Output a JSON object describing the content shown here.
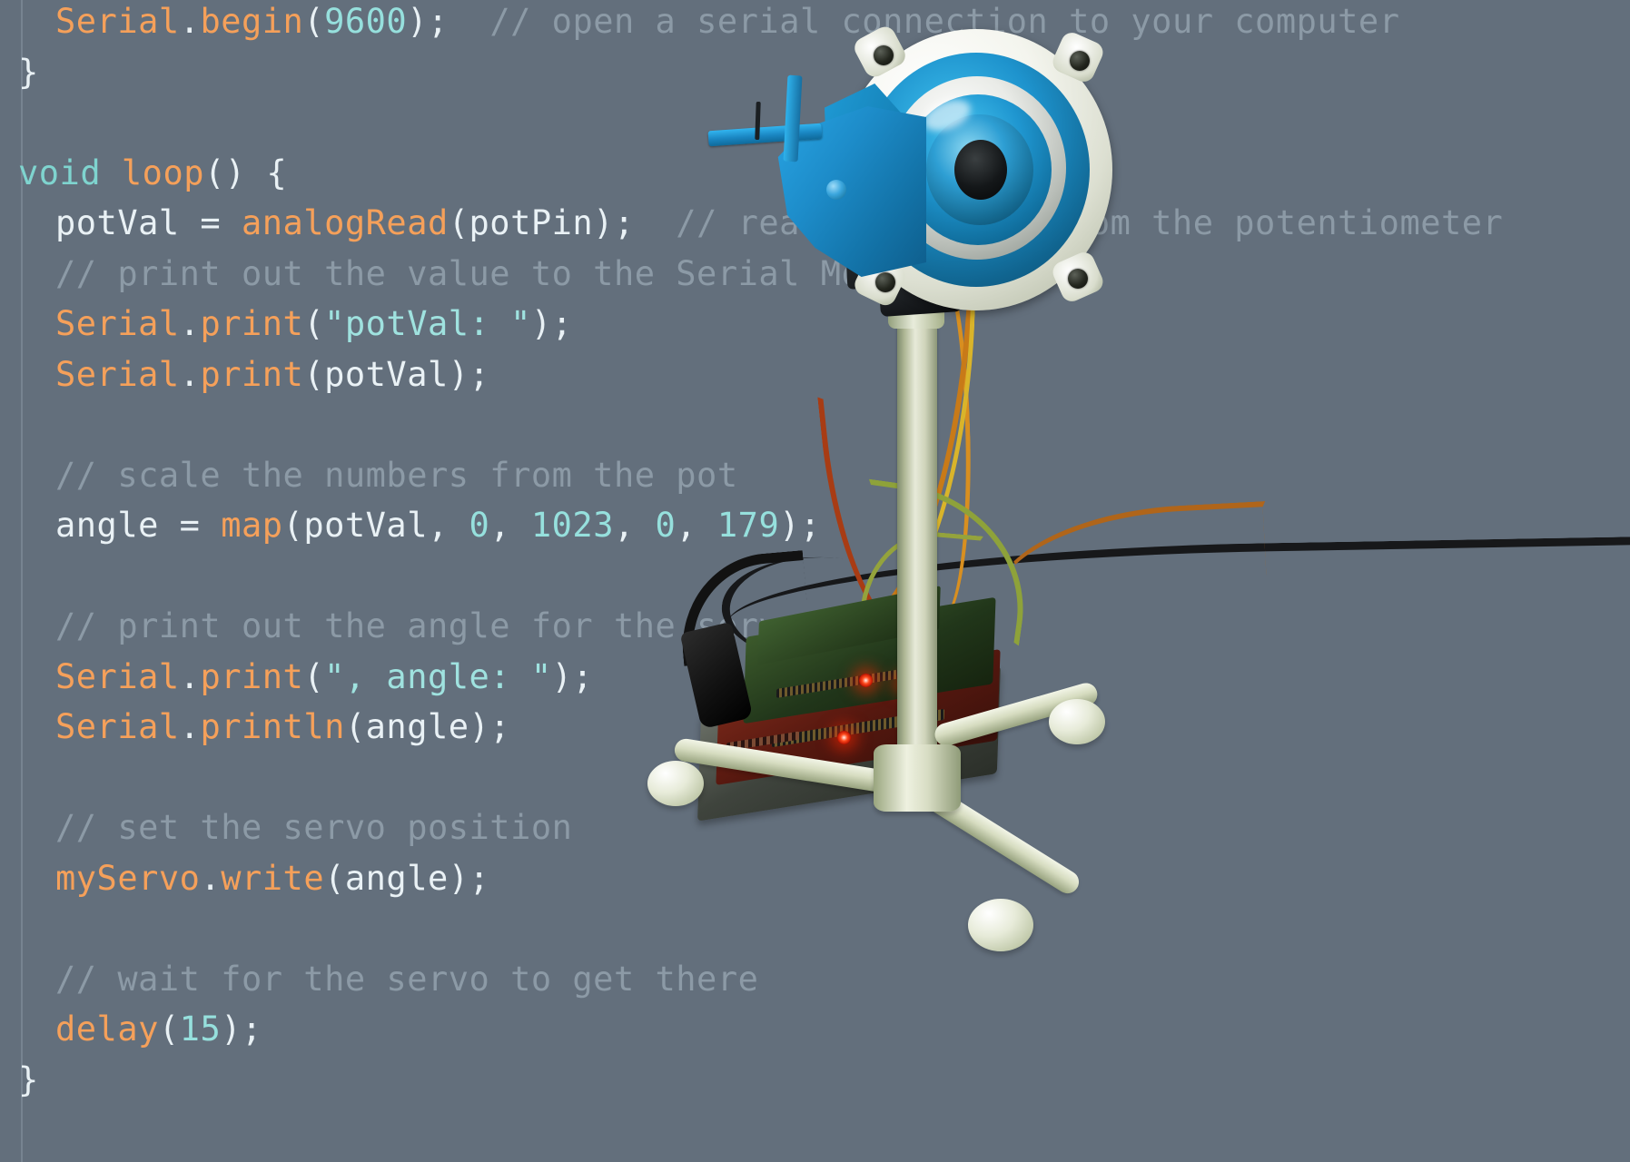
{
  "editor": {
    "language": "arduino",
    "background_color": "#636f7c",
    "comment_color": "#8c9aa6",
    "function_color": "#f5a05a",
    "keyword_color": "#7fd4cf",
    "number_color": "#96e0dd",
    "plain_color": "#e9f1f5",
    "lines": [
      {
        "indent": 1,
        "tokens": [
          {
            "t": "obj",
            "v": "Serial"
          },
          {
            "t": "plain",
            "v": "."
          },
          {
            "t": "fn",
            "v": "begin"
          },
          {
            "t": "plain",
            "v": "("
          },
          {
            "t": "num",
            "v": "9600"
          },
          {
            "t": "plain",
            "v": ");"
          },
          {
            "t": "plain",
            "v": "  "
          },
          {
            "t": "cmt",
            "v": "// open a serial connection to your computer"
          }
        ]
      },
      {
        "indent": 0,
        "tokens": [
          {
            "t": "brace",
            "v": "}"
          }
        ]
      },
      {
        "indent": 0,
        "tokens": []
      },
      {
        "indent": 0,
        "tokens": [
          {
            "t": "kw",
            "v": "void"
          },
          {
            "t": "plain",
            "v": " "
          },
          {
            "t": "fn",
            "v": "loop"
          },
          {
            "t": "plain",
            "v": "() "
          },
          {
            "t": "brace",
            "v": "{"
          }
        ]
      },
      {
        "indent": 1,
        "tokens": [
          {
            "t": "plain",
            "v": "potVal = "
          },
          {
            "t": "fn",
            "v": "analogRead"
          },
          {
            "t": "plain",
            "v": "(potPin);"
          },
          {
            "t": "plain",
            "v": "  "
          },
          {
            "t": "cmt",
            "v": "// read the value from the potentiometer"
          }
        ]
      },
      {
        "indent": 1,
        "tokens": [
          {
            "t": "cmt",
            "v": "// print out the value to the Serial Monitor"
          }
        ]
      },
      {
        "indent": 1,
        "tokens": [
          {
            "t": "obj",
            "v": "Serial"
          },
          {
            "t": "plain",
            "v": "."
          },
          {
            "t": "fn",
            "v": "print"
          },
          {
            "t": "plain",
            "v": "("
          },
          {
            "t": "str",
            "v": "\"potVal: \""
          },
          {
            "t": "plain",
            "v": ");"
          }
        ]
      },
      {
        "indent": 1,
        "tokens": [
          {
            "t": "obj",
            "v": "Serial"
          },
          {
            "t": "plain",
            "v": "."
          },
          {
            "t": "fn",
            "v": "print"
          },
          {
            "t": "plain",
            "v": "(potVal);"
          }
        ]
      },
      {
        "indent": 0,
        "tokens": []
      },
      {
        "indent": 1,
        "tokens": [
          {
            "t": "cmt",
            "v": "// scale the numbers from the pot"
          }
        ]
      },
      {
        "indent": 1,
        "tokens": [
          {
            "t": "plain",
            "v": "angle = "
          },
          {
            "t": "fn",
            "v": "map"
          },
          {
            "t": "plain",
            "v": "(potVal, "
          },
          {
            "t": "num",
            "v": "0"
          },
          {
            "t": "plain",
            "v": ", "
          },
          {
            "t": "num",
            "v": "1023"
          },
          {
            "t": "plain",
            "v": ", "
          },
          {
            "t": "num",
            "v": "0"
          },
          {
            "t": "plain",
            "v": ", "
          },
          {
            "t": "num",
            "v": "179"
          },
          {
            "t": "plain",
            "v": ");"
          }
        ]
      },
      {
        "indent": 0,
        "tokens": []
      },
      {
        "indent": 1,
        "tokens": [
          {
            "t": "cmt",
            "v": "// print out the angle for the servo motor"
          }
        ]
      },
      {
        "indent": 1,
        "tokens": [
          {
            "t": "obj",
            "v": "Serial"
          },
          {
            "t": "plain",
            "v": "."
          },
          {
            "t": "fn",
            "v": "print"
          },
          {
            "t": "plain",
            "v": "("
          },
          {
            "t": "str",
            "v": "\", angle: \""
          },
          {
            "t": "plain",
            "v": ");"
          }
        ]
      },
      {
        "indent": 1,
        "tokens": [
          {
            "t": "obj",
            "v": "Serial"
          },
          {
            "t": "plain",
            "v": "."
          },
          {
            "t": "fn",
            "v": "println"
          },
          {
            "t": "plain",
            "v": "(angle);"
          }
        ]
      },
      {
        "indent": 0,
        "tokens": []
      },
      {
        "indent": 1,
        "tokens": [
          {
            "t": "cmt",
            "v": "// set the servo position"
          }
        ]
      },
      {
        "indent": 1,
        "tokens": [
          {
            "t": "obj",
            "v": "myServo"
          },
          {
            "t": "plain",
            "v": "."
          },
          {
            "t": "fn",
            "v": "write"
          },
          {
            "t": "plain",
            "v": "(angle);"
          }
        ]
      },
      {
        "indent": 0,
        "tokens": []
      },
      {
        "indent": 1,
        "tokens": [
          {
            "t": "cmt",
            "v": "// wait for the servo to get there"
          }
        ]
      },
      {
        "indent": 1,
        "tokens": [
          {
            "t": "fn",
            "v": "delay"
          },
          {
            "t": "plain",
            "v": "("
          },
          {
            "t": "num",
            "v": "15"
          },
          {
            "t": "plain",
            "v": ");"
          }
        ]
      },
      {
        "indent": 0,
        "tokens": [
          {
            "t": "brace",
            "v": "}"
          }
        ]
      }
    ]
  },
  "photo": {
    "subject": "3d-printed-robotic-eye-on-tripod-with-arduino",
    "eye_pupil_color": "#141719",
    "eye_iris_color": "#2e9fd4",
    "bracket_color": "#1d8cc9",
    "bezel_color": "#f4f5ee",
    "stand_color": "#dfe3cf",
    "board_led_color": "#ff4b1e",
    "cable_color": "#17181a",
    "servo_wire_colors": [
      "#c87a18",
      "#d9b42a",
      "#a83c14",
      "#8ea23a"
    ]
  }
}
